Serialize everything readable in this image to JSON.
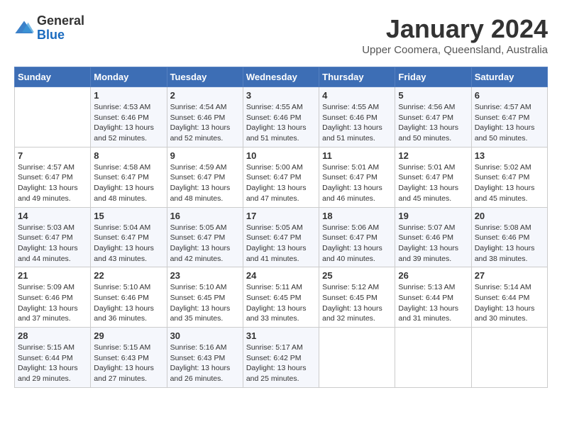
{
  "header": {
    "logo_line1": "General",
    "logo_line2": "Blue",
    "month_title": "January 2024",
    "subtitle": "Upper Coomera, Queensland, Australia"
  },
  "weekdays": [
    "Sunday",
    "Monday",
    "Tuesday",
    "Wednesday",
    "Thursday",
    "Friday",
    "Saturday"
  ],
  "weeks": [
    [
      {
        "day": "",
        "info": ""
      },
      {
        "day": "1",
        "info": "Sunrise: 4:53 AM\nSunset: 6:46 PM\nDaylight: 13 hours\nand 52 minutes."
      },
      {
        "day": "2",
        "info": "Sunrise: 4:54 AM\nSunset: 6:46 PM\nDaylight: 13 hours\nand 52 minutes."
      },
      {
        "day": "3",
        "info": "Sunrise: 4:55 AM\nSunset: 6:46 PM\nDaylight: 13 hours\nand 51 minutes."
      },
      {
        "day": "4",
        "info": "Sunrise: 4:55 AM\nSunset: 6:46 PM\nDaylight: 13 hours\nand 51 minutes."
      },
      {
        "day": "5",
        "info": "Sunrise: 4:56 AM\nSunset: 6:47 PM\nDaylight: 13 hours\nand 50 minutes."
      },
      {
        "day": "6",
        "info": "Sunrise: 4:57 AM\nSunset: 6:47 PM\nDaylight: 13 hours\nand 50 minutes."
      }
    ],
    [
      {
        "day": "7",
        "info": "Sunrise: 4:57 AM\nSunset: 6:47 PM\nDaylight: 13 hours\nand 49 minutes."
      },
      {
        "day": "8",
        "info": "Sunrise: 4:58 AM\nSunset: 6:47 PM\nDaylight: 13 hours\nand 48 minutes."
      },
      {
        "day": "9",
        "info": "Sunrise: 4:59 AM\nSunset: 6:47 PM\nDaylight: 13 hours\nand 48 minutes."
      },
      {
        "day": "10",
        "info": "Sunrise: 5:00 AM\nSunset: 6:47 PM\nDaylight: 13 hours\nand 47 minutes."
      },
      {
        "day": "11",
        "info": "Sunrise: 5:01 AM\nSunset: 6:47 PM\nDaylight: 13 hours\nand 46 minutes."
      },
      {
        "day": "12",
        "info": "Sunrise: 5:01 AM\nSunset: 6:47 PM\nDaylight: 13 hours\nand 45 minutes."
      },
      {
        "day": "13",
        "info": "Sunrise: 5:02 AM\nSunset: 6:47 PM\nDaylight: 13 hours\nand 45 minutes."
      }
    ],
    [
      {
        "day": "14",
        "info": "Sunrise: 5:03 AM\nSunset: 6:47 PM\nDaylight: 13 hours\nand 44 minutes."
      },
      {
        "day": "15",
        "info": "Sunrise: 5:04 AM\nSunset: 6:47 PM\nDaylight: 13 hours\nand 43 minutes."
      },
      {
        "day": "16",
        "info": "Sunrise: 5:05 AM\nSunset: 6:47 PM\nDaylight: 13 hours\nand 42 minutes."
      },
      {
        "day": "17",
        "info": "Sunrise: 5:05 AM\nSunset: 6:47 PM\nDaylight: 13 hours\nand 41 minutes."
      },
      {
        "day": "18",
        "info": "Sunrise: 5:06 AM\nSunset: 6:47 PM\nDaylight: 13 hours\nand 40 minutes."
      },
      {
        "day": "19",
        "info": "Sunrise: 5:07 AM\nSunset: 6:46 PM\nDaylight: 13 hours\nand 39 minutes."
      },
      {
        "day": "20",
        "info": "Sunrise: 5:08 AM\nSunset: 6:46 PM\nDaylight: 13 hours\nand 38 minutes."
      }
    ],
    [
      {
        "day": "21",
        "info": "Sunrise: 5:09 AM\nSunset: 6:46 PM\nDaylight: 13 hours\nand 37 minutes."
      },
      {
        "day": "22",
        "info": "Sunrise: 5:10 AM\nSunset: 6:46 PM\nDaylight: 13 hours\nand 36 minutes."
      },
      {
        "day": "23",
        "info": "Sunrise: 5:10 AM\nSunset: 6:45 PM\nDaylight: 13 hours\nand 35 minutes."
      },
      {
        "day": "24",
        "info": "Sunrise: 5:11 AM\nSunset: 6:45 PM\nDaylight: 13 hours\nand 33 minutes."
      },
      {
        "day": "25",
        "info": "Sunrise: 5:12 AM\nSunset: 6:45 PM\nDaylight: 13 hours\nand 32 minutes."
      },
      {
        "day": "26",
        "info": "Sunrise: 5:13 AM\nSunset: 6:44 PM\nDaylight: 13 hours\nand 31 minutes."
      },
      {
        "day": "27",
        "info": "Sunrise: 5:14 AM\nSunset: 6:44 PM\nDaylight: 13 hours\nand 30 minutes."
      }
    ],
    [
      {
        "day": "28",
        "info": "Sunrise: 5:15 AM\nSunset: 6:44 PM\nDaylight: 13 hours\nand 29 minutes."
      },
      {
        "day": "29",
        "info": "Sunrise: 5:15 AM\nSunset: 6:43 PM\nDaylight: 13 hours\nand 27 minutes."
      },
      {
        "day": "30",
        "info": "Sunrise: 5:16 AM\nSunset: 6:43 PM\nDaylight: 13 hours\nand 26 minutes."
      },
      {
        "day": "31",
        "info": "Sunrise: 5:17 AM\nSunset: 6:42 PM\nDaylight: 13 hours\nand 25 minutes."
      },
      {
        "day": "",
        "info": ""
      },
      {
        "day": "",
        "info": ""
      },
      {
        "day": "",
        "info": ""
      }
    ]
  ]
}
